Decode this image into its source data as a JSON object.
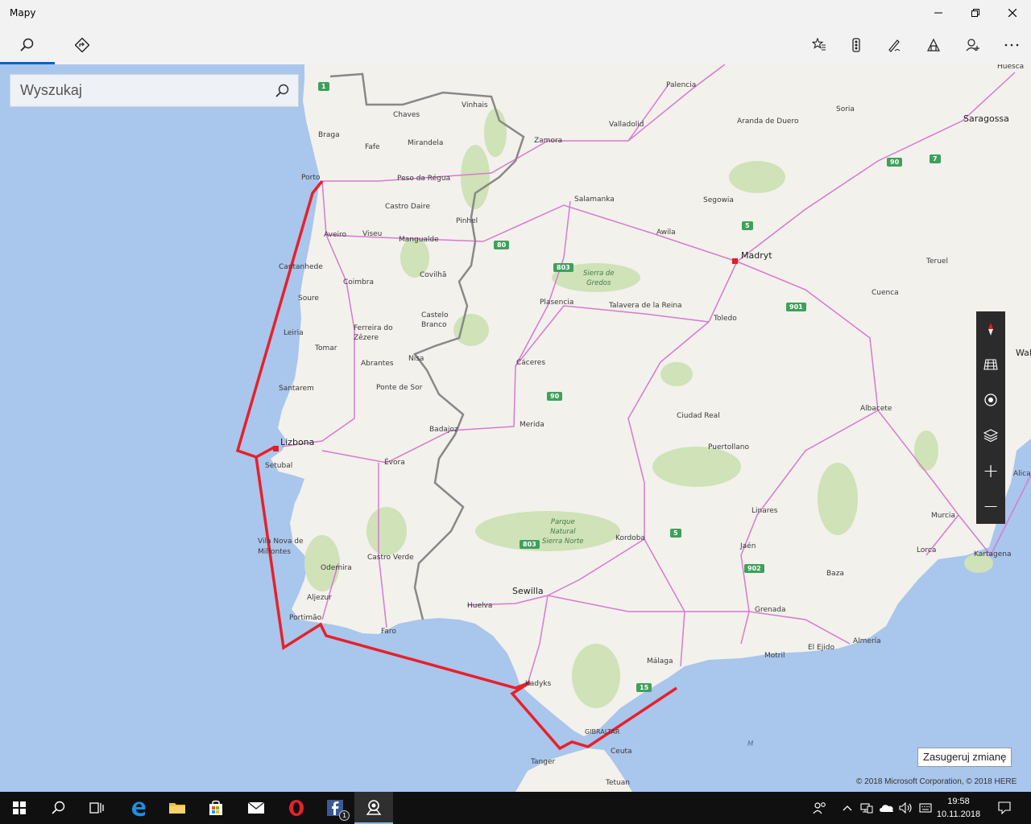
{
  "app": {
    "title": "Mapy"
  },
  "search": {
    "placeholder": "Wyszukaj"
  },
  "map": {
    "cities": {
      "porto": "Porto",
      "braga": "Braga",
      "fafe": "Fafe",
      "chaves": "Chaves",
      "vinhais": "Vinhais",
      "mirandela": "Mirandela",
      "peso": "Peso da Régua",
      "castro_daire": "Castro Daire",
      "pinhel": "Pinhel",
      "aveiro": "Aveiro",
      "viseu": "Viseu",
      "mangualde": "Mangualde",
      "cantanhede": "Cantanhede",
      "coimbra": "Coimbra",
      "covilha": "Covilhã",
      "soure": "Soure",
      "castelo": "Castelo\nBranco",
      "leiria": "Leiria",
      "ferreira": "Ferreira do\nZêzere",
      "tomar": "Tomar",
      "abrantes": "Abrantes",
      "nisa": "Nisa",
      "santarem": "Santarem",
      "ponte": "Ponte de Sor",
      "lizbona": "Lizbona",
      "setubal": "Setubal",
      "evora": "Évora",
      "badajoz": "Badajoz",
      "vila_nova": "Vila Nova de\nMilfontes",
      "odemira": "Odemira",
      "castro_verde": "Castro Verde",
      "aljezur": "Aljezur",
      "portimao": "Portimão",
      "faro": "Faro",
      "huelva": "Huelva",
      "sewilla": "Sewilla",
      "kadyks": "Kadyks",
      "malaga": "Málaga",
      "gibraltar": "GIBRALTAR",
      "ceuta": "Ceuta",
      "tanger": "Tanger",
      "tetuan": "Tetuan",
      "zamora": "Zamora",
      "salamanka": "Salamanka",
      "valladolid": "Valladolid",
      "palencia": "Palencia",
      "aranda": "Aranda de Duero",
      "soria": "Soria",
      "saragossa": "Saragossa",
      "huesca": "Huesca",
      "segowia": "Segowia",
      "awila": "Awila",
      "madryt": "Madryt",
      "teruel": "Teruel",
      "cuenca": "Cuenca",
      "plasencia": "Plasencia",
      "talavera": "Talavera de la Reina",
      "toledo": "Toledo",
      "caceres": "Cáceres",
      "merida": "Merida",
      "ciudad_real": "Ciudad Real",
      "puertollano": "Puertollano",
      "albacete": "Albacete",
      "linares": "Linares",
      "kordoba": "Kordoba",
      "jaen": "Jaén",
      "murcia": "Murcia",
      "lorca": "Lorca",
      "kartagena": "Kartagena",
      "baza": "Baza",
      "grenada": "Grenada",
      "el_ejido": "El Ejido",
      "almeria": "Almería",
      "motril": "Motril",
      "walencja": "Wal",
      "alicante": "Alica"
    },
    "features": {
      "sierra_gredos": "Sierra de\nGredos",
      "sierra_norte": "Parque\nNatural\nSierra Norte",
      "sea_m": "M"
    },
    "road_shields": [
      "1",
      "80",
      "803",
      "90",
      "5",
      "901",
      "90",
      "7",
      "803",
      "5",
      "902",
      "15"
    ],
    "colors": {
      "sea": "#a9c6ec",
      "land": "#f2f1ec",
      "route": "#e8202a",
      "roads": "#d879d0"
    }
  },
  "controls": {
    "compass": "compass-icon",
    "streetside": "3d-cities-icon",
    "location": "location-icon",
    "layers": "layers-icon",
    "zoom_in": "+",
    "zoom_out": "−"
  },
  "suggest_change": "Zasugeruj zmianę",
  "copyright": "© 2018 Microsoft Corporation, © 2018 HERE",
  "taskbar": {
    "time": "19:58",
    "date": "10.11.2018",
    "fb_badge": "1"
  }
}
